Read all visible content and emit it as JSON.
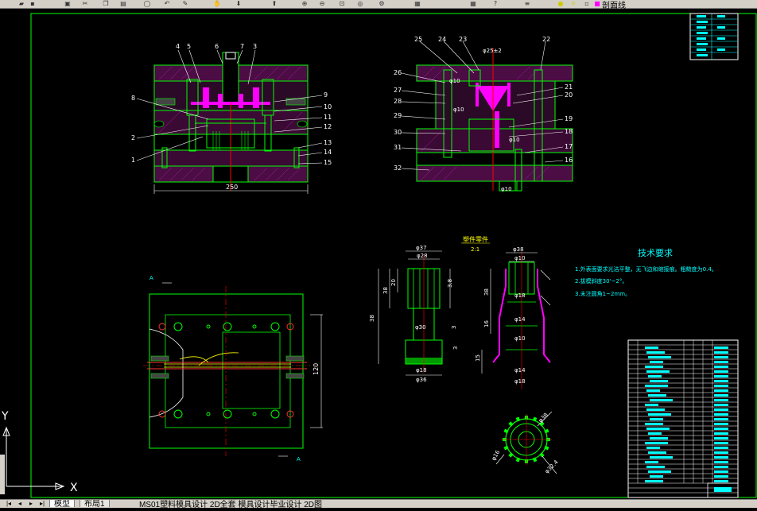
{
  "app": {
    "layer_name": "剖面线"
  },
  "tabs": {
    "model": "模型",
    "layout": "布局1",
    "status": "MS01塑料模具设计 2D全套    模具设计毕业设计      2D图"
  },
  "ucs": {
    "x": "X",
    "y": "Y"
  },
  "drawing": {
    "view1": {
      "labels_left": [
        "4",
        "5",
        "6",
        "7",
        "3",
        "8",
        "2",
        "1"
      ],
      "labels_right": [
        "9",
        "10",
        "11",
        "12",
        "13",
        "14",
        "15"
      ],
      "dim_width": "250"
    },
    "view2": {
      "labels_left": [
        "25",
        "24",
        "23",
        "26",
        "27",
        "28",
        "29",
        "30",
        "31",
        "32"
      ],
      "labels_right": [
        "22",
        "21",
        "20",
        "19",
        "18",
        "17",
        "16"
      ],
      "dim_top": "φ25±2",
      "dim_a": "φ10",
      "dim_b": "φ10",
      "dim_c": "φ10",
      "dim_bottom": "φ10"
    },
    "part": {
      "title": "塑件零件",
      "scale": "2:1",
      "dims_left_top": [
        "φ37",
        "φ28"
      ],
      "dims_left_bottom": [
        "φ30",
        "φ18",
        "φ36"
      ],
      "dims_side": [
        "38",
        "38",
        "20",
        "3.8",
        "3",
        "3"
      ],
      "dims_right_top": [
        "φ38",
        "φ10"
      ],
      "dims_right_mid": [
        "φ18",
        "φ14",
        "φ10",
        "φ14",
        "φ18"
      ],
      "dims_right_side": [
        "38",
        "16",
        "15"
      ]
    },
    "plan": {
      "section_mark": "A",
      "dim_height": "120"
    },
    "tech": {
      "title": "技术要求",
      "items": [
        "1.外表面要求光洁平整，无飞边和缩接痕。粗糙度为0.4。",
        "2.拔模斜度30'~2°。",
        "3.未注圆角1~2mm。"
      ]
    },
    "gear": {
      "dims": [
        "φ38",
        "φ16",
        "φ32.4"
      ]
    }
  }
}
